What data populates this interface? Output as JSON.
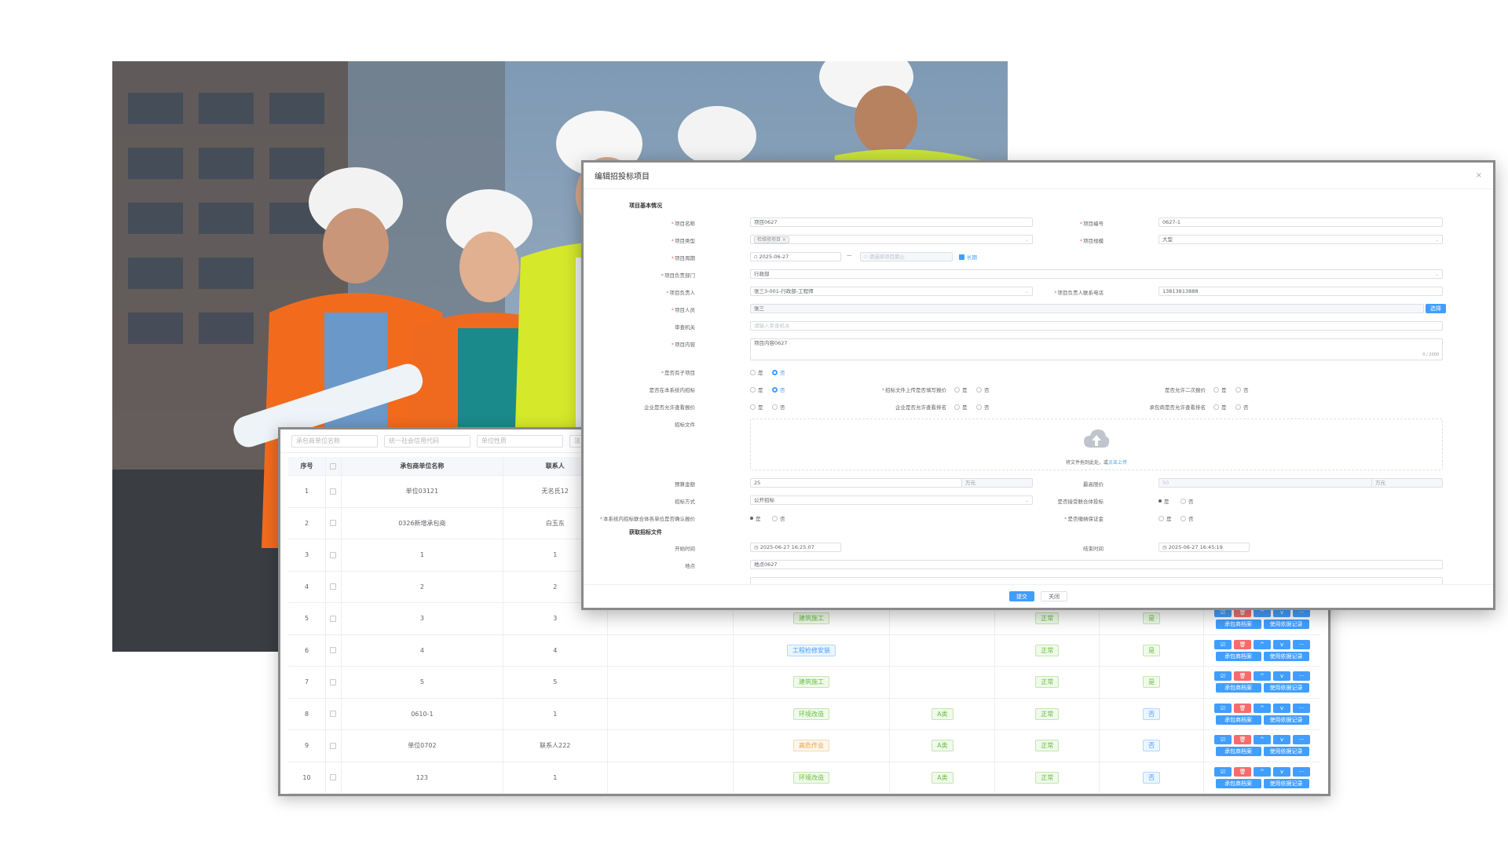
{
  "table": {
    "filters": [
      "承包商单位名称",
      "统一社会信用代码",
      "单位性质",
      "法"
    ],
    "headers": [
      "序号",
      "承包商单位名称",
      "联系人"
    ],
    "rows": [
      {
        "no": "1",
        "name": "单位03121",
        "contact": "无名氏12",
        "type": "",
        "level": "",
        "status": "",
        "flag": ""
      },
      {
        "no": "2",
        "name": "0326新增承包商",
        "contact": "白玉东",
        "type": "",
        "level": "",
        "status": "",
        "flag": ""
      },
      {
        "no": "3",
        "name": "1",
        "contact": "1",
        "type": "",
        "level": "",
        "status": "",
        "flag": ""
      },
      {
        "no": "4",
        "name": "2",
        "contact": "2",
        "type": "",
        "level": "",
        "status": "",
        "flag": ""
      },
      {
        "no": "5",
        "name": "3",
        "contact": "3",
        "type": "建筑施工",
        "level": "",
        "status": "正常",
        "flag": "是"
      },
      {
        "no": "6",
        "name": "4",
        "contact": "4",
        "type": "工程检修安装",
        "level": "",
        "status": "正常",
        "flag": "是"
      },
      {
        "no": "7",
        "name": "5",
        "contact": "5",
        "type": "建筑施工",
        "level": "",
        "status": "正常",
        "flag": "是"
      },
      {
        "no": "8",
        "name": "0610-1",
        "contact": "1",
        "type": "环境改造",
        "level": "A类",
        "status": "正常",
        "flag": "否"
      },
      {
        "no": "9",
        "name": "单位0702",
        "contact": "联系人222",
        "type": "高危作业",
        "level": "A类",
        "status": "正常",
        "flag": "否"
      },
      {
        "no": "10",
        "name": "123",
        "contact": "1",
        "type": "环境改造",
        "level": "A类",
        "status": "正常",
        "flag": "否"
      }
    ],
    "op_buttons": {
      "edit": "☑",
      "delete": "🗑",
      "up": "^",
      "down": "v",
      "more": "···",
      "archive": "承包商档案",
      "record": "使用依据记录"
    }
  },
  "dialog": {
    "title": "编辑招投标项目",
    "close": "×",
    "section_basic": "项目基本情况",
    "section_bid": "获取招标文件",
    "fields": {
      "project_name": {
        "label": "项目名称",
        "value": "项目0627"
      },
      "project_no": {
        "label": "项目编号",
        "value": "0627-1"
      },
      "project_type": {
        "label": "项目类型",
        "value": "检维修项目 ×"
      },
      "project_scale": {
        "label": "项目规模",
        "value": "大型"
      },
      "project_period": {
        "label": "项目周期",
        "start": "2025-06-27",
        "end": "请选择项目期止",
        "long": "长期",
        "sep": "—"
      },
      "dept": {
        "label": "项目负责部门",
        "value": "行政部"
      },
      "leader": {
        "label": "项目负责人",
        "value": "张三3-001-行政部-工程师"
      },
      "leader_phone": {
        "label": "项目负责人联系电话",
        "value": "13813813888"
      },
      "members": {
        "label": "项目人员",
        "value": "张三",
        "btn": "选择"
      },
      "supervisor": {
        "label": "审查机关",
        "placeholder": "请输入审查机关"
      },
      "content": {
        "label": "项目内容",
        "value": "项目内容0627",
        "counter": "0 / 2000"
      },
      "is_sub": {
        "label": "是否有子项目",
        "yes": "是",
        "no": "否"
      },
      "in_system": {
        "label": "是否在本系统内招标",
        "yes": "是",
        "no": "否"
      },
      "upload_quote": {
        "label": "招标文件上传是否填写报价",
        "yes": "是",
        "no": "否"
      },
      "second_quote": {
        "label": "是否允许二次报价",
        "yes": "是",
        "no": "否"
      },
      "view_quote": {
        "label": "企业是否允许查看报价",
        "yes": "是",
        "no": "否"
      },
      "view_rank": {
        "label": "企业是否允许查看排名",
        "yes": "是",
        "no": "否"
      },
      "contractor_view": {
        "label": "承包商是否允许查看排名",
        "yes": "是",
        "no": "否"
      },
      "bid_file": {
        "label": "招标文件",
        "hint": "将文件拖到此处，或",
        "link": "点击上传"
      },
      "budget": {
        "label": "预算金额",
        "value": "25",
        "unit": "万元"
      },
      "max_price": {
        "label": "最高限价",
        "value": "50",
        "unit": "万元"
      },
      "bid_method": {
        "label": "招标方式",
        "value": "公开招标"
      },
      "consortium": {
        "label": "是否接受联合体投标",
        "yes": "是",
        "no": "否"
      },
      "confirm_price": {
        "label": "本系统内招标联合体各单位是否确认报价",
        "yes": "是",
        "no": "否"
      },
      "security": {
        "label": "是否缴纳保证金",
        "yes": "是",
        "no": "否"
      },
      "start_time": {
        "label": "开始时间",
        "value": "2025-06-27 16:25:07"
      },
      "end_time": {
        "label": "结束时间",
        "value": "2025-06-27 16:45:19"
      },
      "place": {
        "label": "地点",
        "value": "地点0627"
      }
    },
    "submit": "提交",
    "cancel": "关闭"
  }
}
